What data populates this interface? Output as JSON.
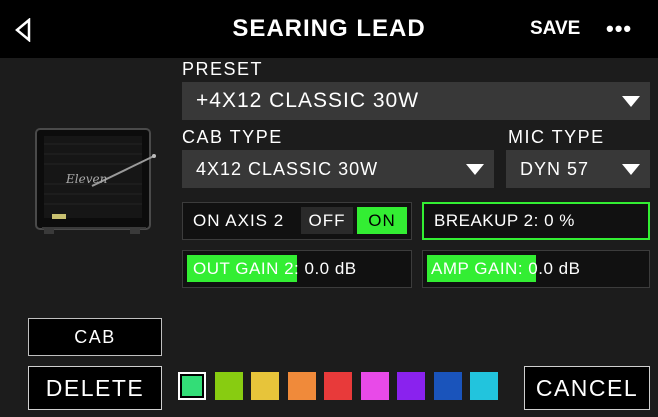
{
  "header": {
    "title": "SEARING LEAD",
    "save_label": "SAVE",
    "more_label": "•••"
  },
  "cabinet_image": {
    "brand": "Eleven"
  },
  "preset": {
    "label": "PRESET",
    "value": "+4X12 CLASSIC 30W"
  },
  "cab_type": {
    "label": "CAB TYPE",
    "value": "4X12 CLASSIC 30W"
  },
  "mic_type": {
    "label": "MIC TYPE",
    "value": "DYN 57"
  },
  "on_axis": {
    "label": "ON AXIS 2",
    "off_label": "OFF",
    "on_label": "ON",
    "selected": "ON"
  },
  "breakup": {
    "text": "BREAKUP 2: 0 %",
    "level": 0
  },
  "out_gain": {
    "text": "OUT GAIN 2: 0.0 dB",
    "level": 0.5
  },
  "amp_gain": {
    "text": "AMP GAIN: 0.0 dB",
    "level": 0.5
  },
  "cab_button_label": "CAB",
  "delete_button_label": "DELETE",
  "cancel_button_label": "CANCEL",
  "swatches": [
    {
      "color": "#33dd77",
      "selected": true
    },
    {
      "color": "#88cc11",
      "selected": false
    },
    {
      "color": "#e7c43a",
      "selected": false
    },
    {
      "color": "#f08a3a",
      "selected": false
    },
    {
      "color": "#e83a3a",
      "selected": false
    },
    {
      "color": "#e84ae8",
      "selected": false
    },
    {
      "color": "#8a22ee",
      "selected": false
    },
    {
      "color": "#1a54bb",
      "selected": false
    },
    {
      "color": "#22c4dd",
      "selected": false
    }
  ]
}
